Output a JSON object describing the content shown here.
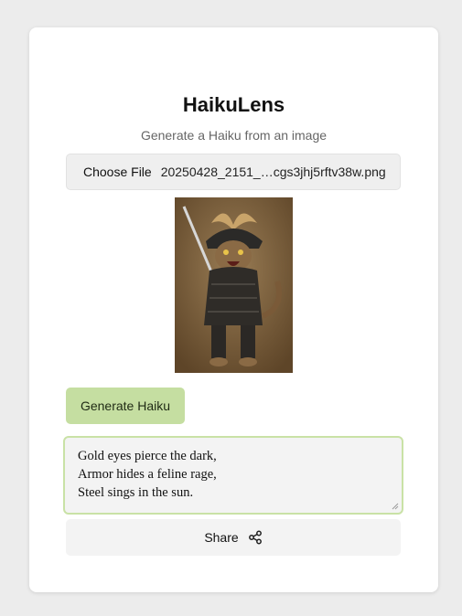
{
  "app": {
    "title": "HaikuLens",
    "subtitle": "Generate a Haiku from an image"
  },
  "file_input": {
    "button_label": "Choose File",
    "file_name": "20250428_2151_…cgs3jhj5rftv38w.png"
  },
  "preview": {
    "icon": "samurai-cat-image"
  },
  "generate": {
    "label": "Generate Haiku"
  },
  "haiku": {
    "lines": [
      "Gold eyes pierce the dark,",
      "Armor hides a feline rage,",
      "Steel sings in the sun."
    ]
  },
  "share": {
    "label": "Share",
    "icon": "share-icon"
  },
  "colors": {
    "page_bg": "#ececec",
    "card_bg": "#ffffff",
    "accent_green": "#c5dea1",
    "focus_green": "#c9e2a6"
  }
}
